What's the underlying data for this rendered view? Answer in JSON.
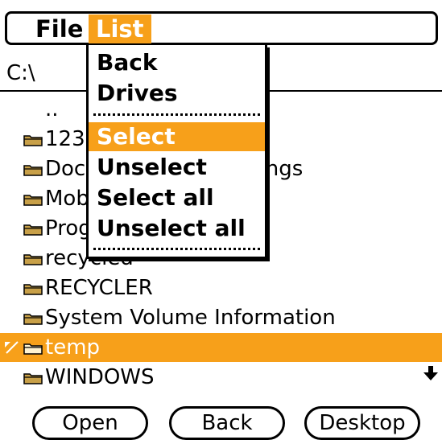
{
  "menubar": {
    "file_label": "File",
    "list_label": "List"
  },
  "path": "C:\\",
  "list_items": [
    {
      "label": "..",
      "icon": "none"
    },
    {
      "label": "123",
      "icon": "folder-icon"
    },
    {
      "label": "Documents and Settings",
      "icon": "folder-icon"
    },
    {
      "label": "MobileSync",
      "icon": "folder-icon"
    },
    {
      "label": "Program Files",
      "icon": "folder-icon"
    },
    {
      "label": "recycled",
      "icon": "folder-icon"
    },
    {
      "label": "RECYCLER",
      "icon": "folder-icon"
    },
    {
      "label": "System Volume Information",
      "icon": "folder-icon"
    },
    {
      "label": "temp",
      "icon": "folder-icon",
      "selected": true,
      "marker": "expand-icon"
    },
    {
      "label": "WINDOWS",
      "icon": "folder-icon"
    }
  ],
  "dropdown": {
    "items": [
      "Back",
      "Drives",
      "Select",
      "Unselect",
      "Select all",
      "Unselect all"
    ],
    "active_item": "Select"
  },
  "buttons": {
    "open_label": "Open",
    "back_label": "Back",
    "desktop_label": "Desktop"
  },
  "colors": {
    "accent": "#f7a01a",
    "folder": "#c8a048",
    "text": "#000000",
    "background": "#ffffff"
  },
  "icons": {
    "scroll": "scroll-down-arrow-icon",
    "expand_marker": "expand-icon"
  }
}
